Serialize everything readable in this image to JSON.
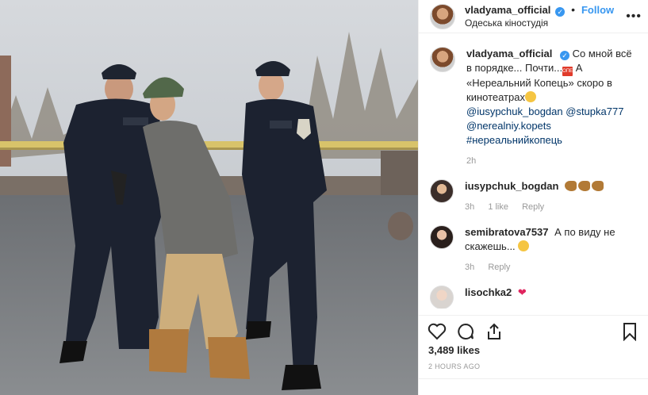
{
  "post": {
    "username": "vladyama_official",
    "verified_mark": "✓",
    "follow_label": "Follow",
    "separator": "•",
    "location": "Одеська кіностудія",
    "more_label": "•••"
  },
  "caption": {
    "username": "vladyama_official",
    "text_1": "Со мной всё в порядке... Почти...",
    "badge_text": "ОПЕ",
    "text_2": " А «Нереальний Копець» скоро в кинотеатрах",
    "mentions": [
      "@iusypchuk_bogdan",
      "@stupka777",
      "@nerealniy.kopets"
    ],
    "hashtag": "#нереальнийкопець",
    "time": "2h"
  },
  "comments": [
    {
      "username": "iusypchuk_bogdan",
      "text": "",
      "time": "3h",
      "likes": "1 like",
      "reply": "Reply"
    },
    {
      "username": "semibratova7537",
      "text": "А по виду не скажешь... ",
      "time": "3h",
      "reply": "Reply"
    },
    {
      "username": "lisochka2",
      "text": ""
    }
  ],
  "actions": {
    "like_icon": "heart-outline-icon",
    "comment_icon": "comment-icon",
    "share_icon": "share-icon",
    "save_icon": "bookmark-icon"
  },
  "likes": "3,489 likes",
  "timestamp": "2 HOURS AGO",
  "colors": {
    "link": "#3897f0",
    "tag": "#003569",
    "muted": "#999999",
    "heart": "#e0245e"
  },
  "photo": {
    "patch_text": "ПОЛІЦІЯ"
  }
}
